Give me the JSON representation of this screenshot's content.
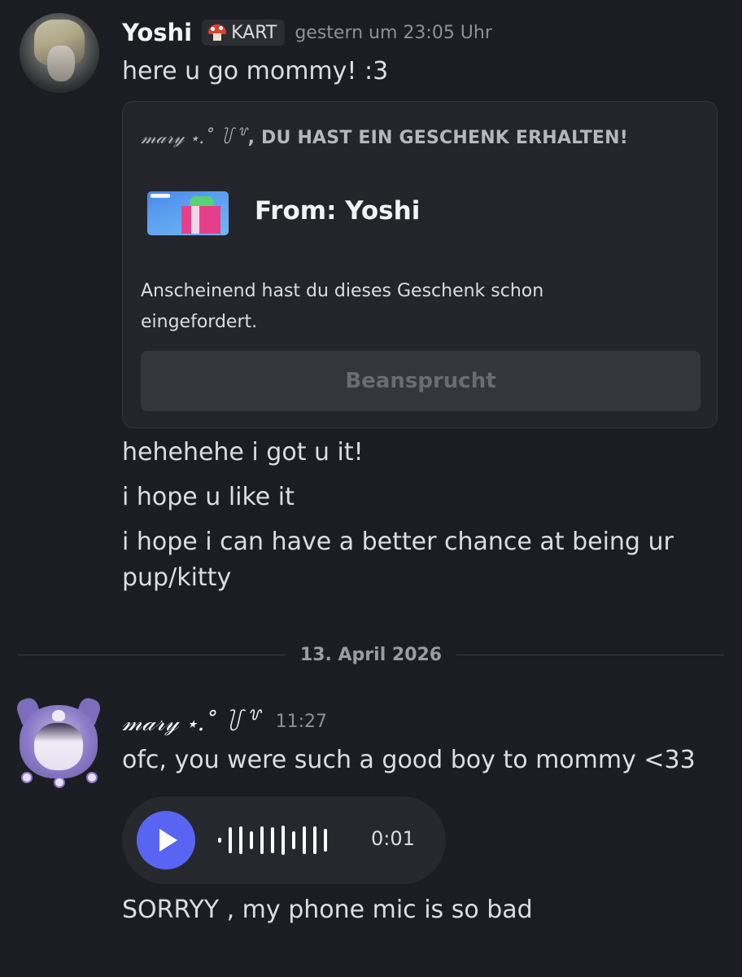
{
  "messages": [
    {
      "author": "Yoshi",
      "tag": "KART",
      "timestamp": "gestern um 23:05 Uhr",
      "text": "here u go mommy! :3",
      "gift": {
        "heading_name": "𝓂𝒶𝓇𝓎 ⋆.˚ ꒦꒷",
        "heading_text": ", DU HAST EIN GESCHENK ERHALTEN!",
        "from": "From: Yoshi",
        "description": "Anscheinend hast du dieses Geschenk schon eingefordert.",
        "button_label": "Beansprucht"
      },
      "followups": [
        "hehehehe i got u it!",
        "i hope u like it",
        "i hope i can have a better chance at being ur pup/kitty"
      ]
    },
    {
      "author": "𝓂𝒶𝓇𝓎 ⋆.˚ ꒦꒷",
      "timestamp": "11:27",
      "text": "ofc, you were such a good boy to mommy <33",
      "voice": {
        "duration": "0:01"
      },
      "followups": [
        "SORRYY , my phone mic is so bad"
      ]
    }
  ],
  "date_divider": "13. April 2026",
  "icons": {
    "tag_icon": "mushroom-icon",
    "play_icon": "play-icon"
  },
  "colors": {
    "background": "#1c1d22",
    "play_button": "#5865f2",
    "card": "#24252b"
  }
}
